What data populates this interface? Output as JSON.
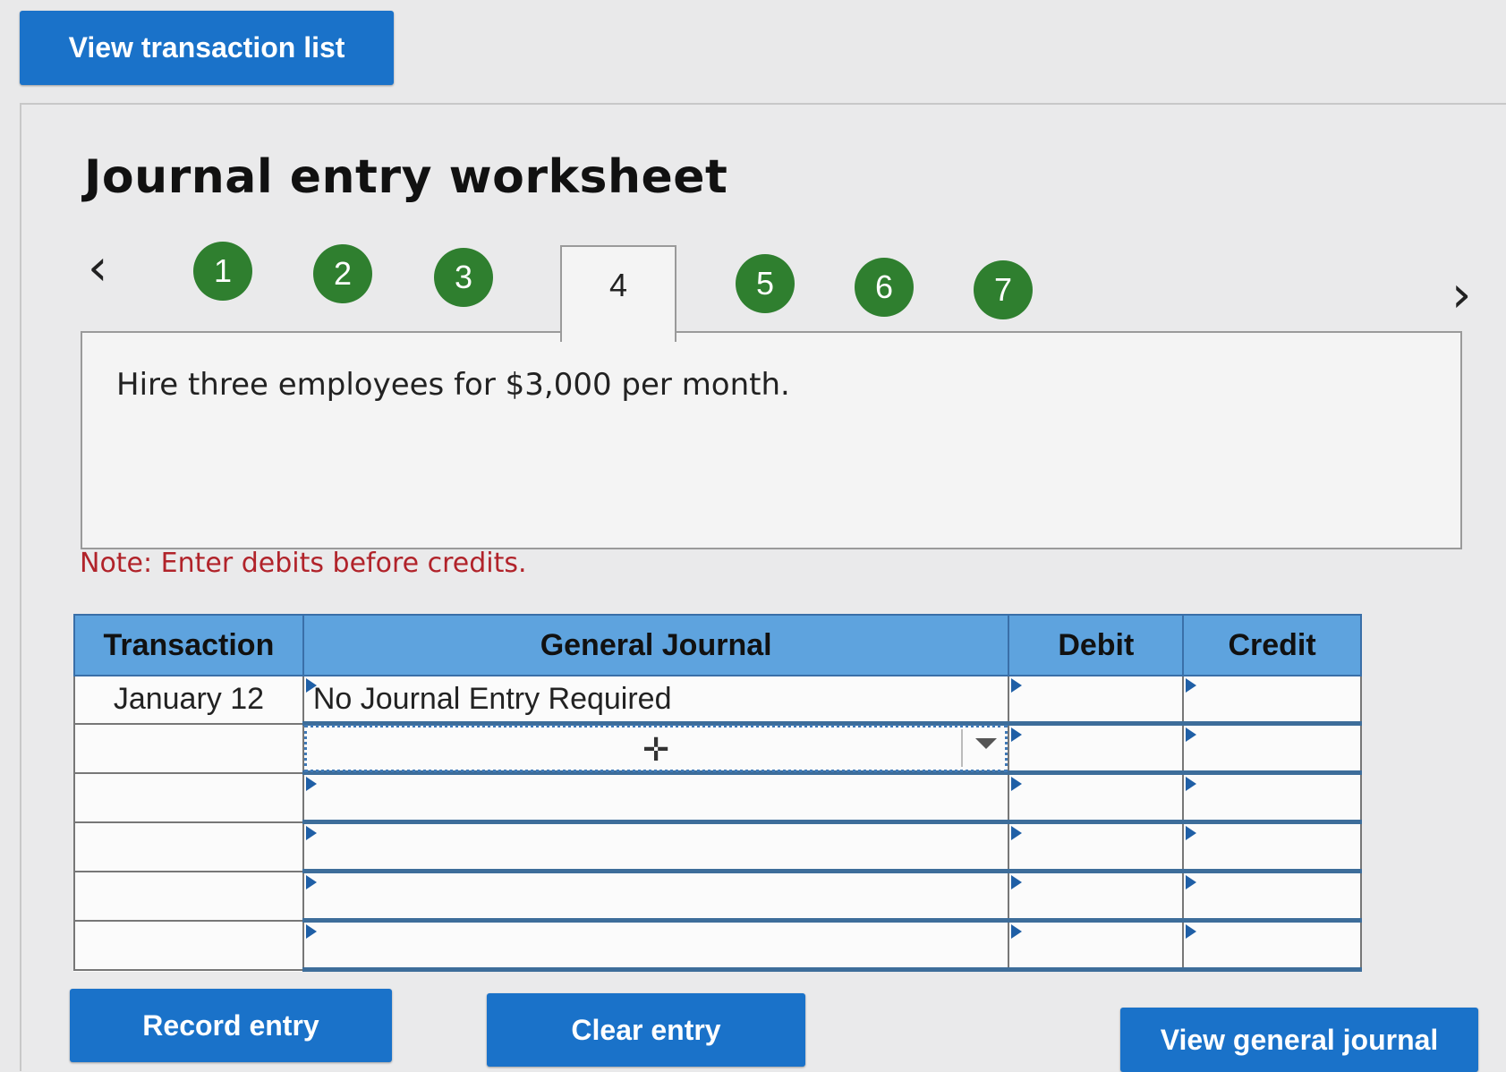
{
  "top_button": "View transaction list",
  "title": "Journal entry worksheet",
  "steps": [
    {
      "label": "1",
      "status": "complete"
    },
    {
      "label": "2",
      "status": "complete"
    },
    {
      "label": "3",
      "status": "complete"
    },
    {
      "label": "4",
      "status": "active"
    },
    {
      "label": "5",
      "status": "complete"
    },
    {
      "label": "6",
      "status": "complete"
    },
    {
      "label": "7",
      "status": "complete"
    }
  ],
  "description": "Hire three employees for $3,000 per month.",
  "note": "Note: Enter debits before credits.",
  "table": {
    "headers": [
      "Transaction",
      "General Journal",
      "Debit",
      "Credit"
    ],
    "rows": [
      {
        "transaction": "January 12",
        "account": "No Journal Entry Required",
        "debit": "",
        "credit": ""
      },
      {
        "transaction": "",
        "account": "",
        "debit": "",
        "credit": ""
      },
      {
        "transaction": "",
        "account": "",
        "debit": "",
        "credit": ""
      },
      {
        "transaction": "",
        "account": "",
        "debit": "",
        "credit": ""
      },
      {
        "transaction": "",
        "account": "",
        "debit": "",
        "credit": ""
      },
      {
        "transaction": "",
        "account": "",
        "debit": "",
        "credit": ""
      }
    ]
  },
  "buttons": {
    "record": "Record entry",
    "clear": "Clear entry",
    "view_journal": "View general journal"
  },
  "colors": {
    "button_blue": "#1a72c9",
    "step_green": "#2f7f2f",
    "header_blue": "#5ea3de",
    "note_red": "#b1232a"
  }
}
